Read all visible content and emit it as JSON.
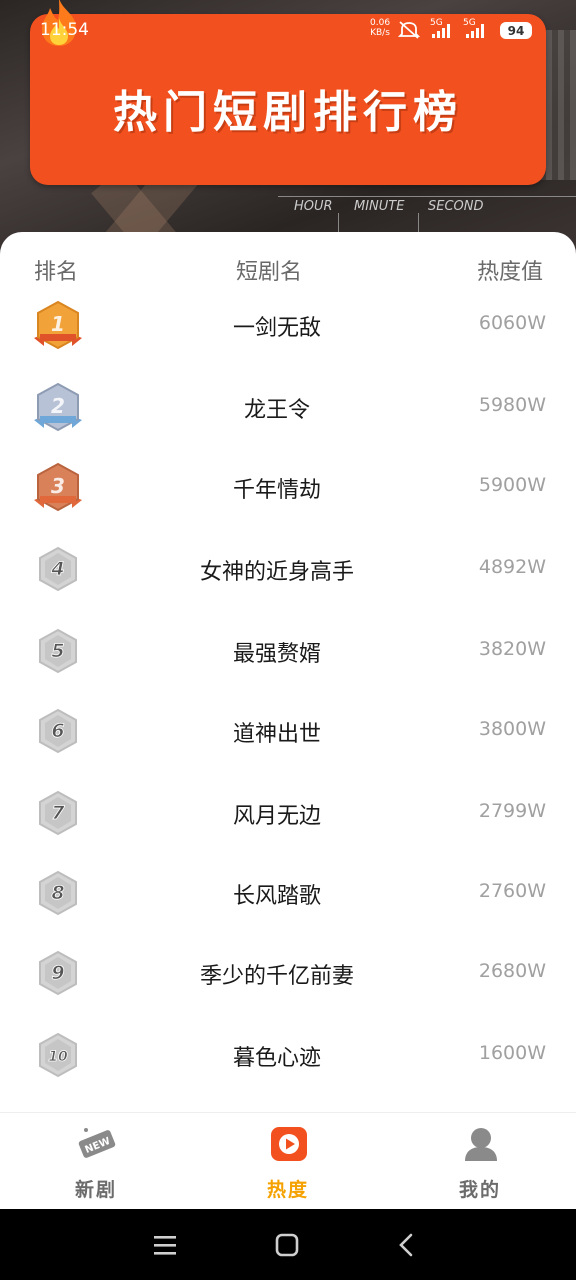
{
  "status_bar": {
    "time": "11:54",
    "net_speed_value": "0.06",
    "net_speed_unit": "KB/s",
    "sig1": "5G",
    "sig2": "5G",
    "battery": "94"
  },
  "header": {
    "banner_title": "热门短剧排行榜",
    "clock_labels": [
      "HOUR",
      "MINUTE",
      "SECOND"
    ],
    "accent_color": "#f2511f"
  },
  "table": {
    "columns": [
      "排名",
      "短剧名",
      "热度值"
    ],
    "rows": [
      {
        "rank": "1",
        "name": "一剑无敌",
        "heat": "6060W"
      },
      {
        "rank": "2",
        "name": "龙王令",
        "heat": "5980W"
      },
      {
        "rank": "3",
        "name": "千年情劫",
        "heat": "5900W"
      },
      {
        "rank": "4",
        "name": "女神的近身高手",
        "heat": "4892W"
      },
      {
        "rank": "5",
        "name": "最强赘婿",
        "heat": "3820W"
      },
      {
        "rank": "6",
        "name": "道神出世",
        "heat": "3800W"
      },
      {
        "rank": "7",
        "name": "风月无边",
        "heat": "2799W"
      },
      {
        "rank": "8",
        "name": "长风踏歌",
        "heat": "2760W"
      },
      {
        "rank": "9",
        "name": "季少的千亿前妻",
        "heat": "2680W"
      },
      {
        "rank": "10",
        "name": "暮色心迹",
        "heat": "1600W"
      }
    ]
  },
  "tabs": [
    {
      "label": "新剧",
      "icon": "new-badge-icon",
      "active": false
    },
    {
      "label": "热度",
      "icon": "play-icon",
      "active": true
    },
    {
      "label": "我的",
      "icon": "user-icon",
      "active": false
    }
  ],
  "colors": {
    "active_tab": "#f5a200",
    "gold": "#f1a33a",
    "silver": "#b8c2d6",
    "bronze": "#d9825a",
    "grey_badge": "#d4d4d4"
  }
}
